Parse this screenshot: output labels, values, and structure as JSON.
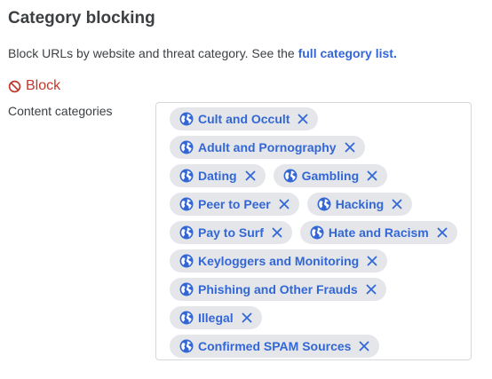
{
  "header": {
    "title": "Category blocking"
  },
  "description": {
    "text": "Block URLs by website and threat category. See the ",
    "link_label": "full category list."
  },
  "block": {
    "label": "Block"
  },
  "content_categories": {
    "label": "Content categories",
    "rows": [
      [
        "Cult and Occult"
      ],
      [
        "Adult and Pornography"
      ],
      [
        "Dating",
        "Gambling"
      ],
      [
        "Peer to Peer",
        "Hacking"
      ],
      [
        "Pay to Surf",
        "Hate and Racism"
      ],
      [
        "Keyloggers and Monitoring"
      ],
      [
        "Phishing and Other Frauds"
      ],
      [
        "Illegal"
      ],
      [
        "Confirmed SPAM Sources"
      ]
    ]
  },
  "icons": {
    "block": "block-icon",
    "chip": "globe-icon",
    "remove": "close-icon"
  },
  "colors": {
    "accent": "#3367d6",
    "block": "#c0392b",
    "chip_bg": "#e4e6ea",
    "border": "#d4d7dc"
  }
}
